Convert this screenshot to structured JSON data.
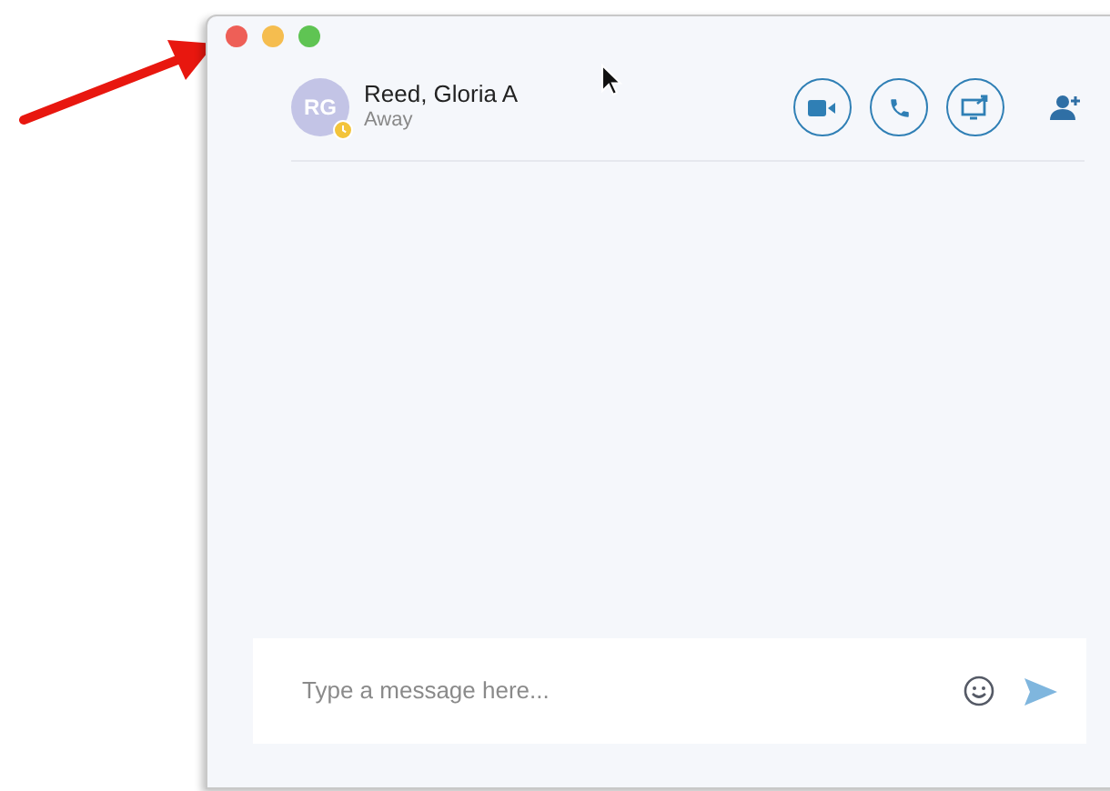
{
  "contact": {
    "initials": "RG",
    "name": "Reed, Gloria A",
    "status": "Away"
  },
  "composer": {
    "placeholder": "Type a message here..."
  }
}
